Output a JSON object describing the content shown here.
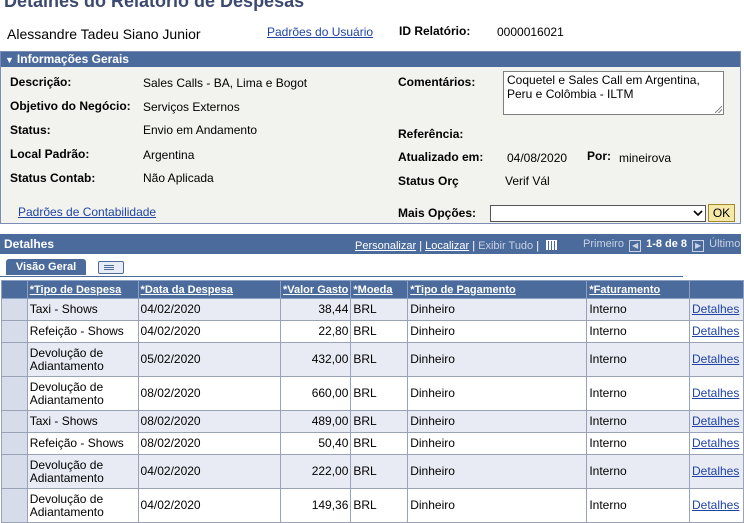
{
  "header": {
    "title": "Detalhes do Relatório de Despesas",
    "employee_name": "Alessandre Tadeu Siano Junior",
    "user_defaults_link": "Padrões do Usuário",
    "report_id_label": "ID Relatório:",
    "report_id_value": "0000016021"
  },
  "general": {
    "section_title": "Informações Gerais",
    "description_label": "Descrição:",
    "description_value": "Sales Calls - BA, Lima e Bogot",
    "business_purpose_label": "Objetivo do Negócio:",
    "business_purpose_value": "Serviços Externos",
    "status_label": "Status:",
    "status_value": "Envio em Andamento",
    "default_location_label": "Local Padrão:",
    "default_location_value": "Argentina",
    "accounting_status_label": "Status Contab:",
    "accounting_status_value": "Não Aplicada",
    "comments_label": "Comentários:",
    "comments_value": "Coquetel e Sales Call em Argentina, Peru e Colômbia - ILTM",
    "reference_label": "Referência:",
    "updated_label": "Atualizado em:",
    "updated_date": "04/08/2020",
    "by_label": "Por:",
    "updated_by": "mineirova",
    "budget_status_label": "Status Orç",
    "budget_status_value": "Verif Vál",
    "accounting_defaults_link": "Padrões de Contabilidade",
    "more_options_label": "Mais Opções:",
    "more_options_value": "",
    "ok_label": "OK"
  },
  "details": {
    "title": "Detalhes",
    "personalize_link": "Personalizar",
    "find_link": "Localizar",
    "view_all": "Exibir Tudo",
    "first_label": "Primeiro",
    "range_label": "1-8 de 8",
    "last_label": "Último",
    "tab_general": "Visão Geral",
    "columns": [
      "*Tipo de Despesa",
      "*Data da Despesa",
      "*Valor Gasto",
      "*Moeda",
      "*Tipo de Pagamento",
      "*Faturamento"
    ],
    "rows": [
      {
        "type": "Taxi - Shows",
        "date": "04/02/2020",
        "amount": "38,44",
        "currency": "BRL",
        "payment": "Dinheiro",
        "billing": "Interno",
        "link": "Detalhes"
      },
      {
        "type": "Refeição - Shows",
        "date": "04/02/2020",
        "amount": "22,80",
        "currency": "BRL",
        "payment": "Dinheiro",
        "billing": "Interno",
        "link": "Detalhes"
      },
      {
        "type": "Devolução de Adiantamento",
        "date": "05/02/2020",
        "amount": "432,00",
        "currency": "BRL",
        "payment": "Dinheiro",
        "billing": "Interno",
        "link": "Detalhes"
      },
      {
        "type": "Devolução de Adiantamento",
        "date": "08/02/2020",
        "amount": "660,00",
        "currency": "BRL",
        "payment": "Dinheiro",
        "billing": "Interno",
        "link": "Detalhes"
      },
      {
        "type": "Taxi - Shows",
        "date": "08/02/2020",
        "amount": "489,00",
        "currency": "BRL",
        "payment": "Dinheiro",
        "billing": "Interno",
        "link": "Detalhes"
      },
      {
        "type": "Refeição - Shows",
        "date": "08/02/2020",
        "amount": "50,40",
        "currency": "BRL",
        "payment": "Dinheiro",
        "billing": "Interno",
        "link": "Detalhes"
      },
      {
        "type": "Devolução de Adiantamento",
        "date": "04/02/2020",
        "amount": "222,00",
        "currency": "BRL",
        "payment": "Dinheiro",
        "billing": "Interno",
        "link": "Detalhes"
      },
      {
        "type": "Devolução de Adiantamento",
        "date": "04/02/2020",
        "amount": "149,36",
        "currency": "BRL",
        "payment": "Dinheiro",
        "billing": "Interno",
        "link": "Detalhes"
      }
    ]
  },
  "colors": {
    "header_blue": "#4b6b9c",
    "link_blue": "#1f44a3",
    "ok_button": "#f6e9a8"
  }
}
